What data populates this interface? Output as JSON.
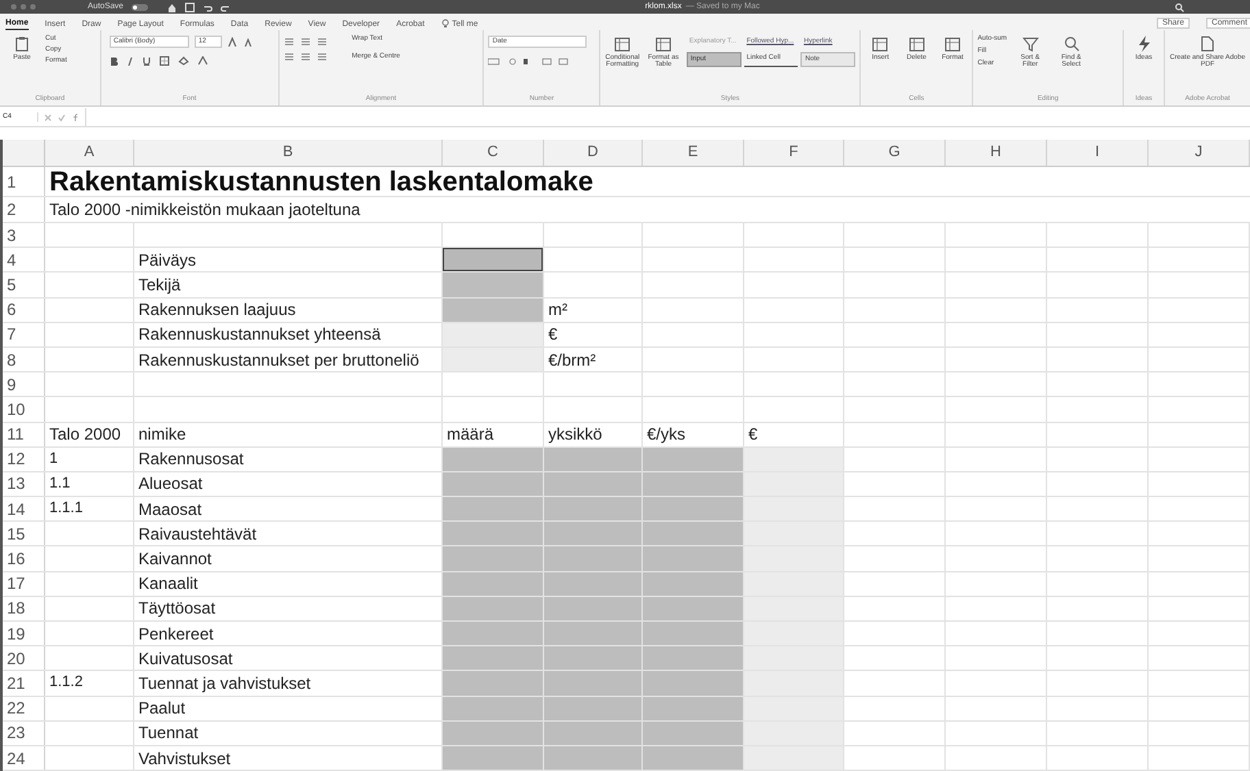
{
  "title_bar": {
    "autosave_label": "AutoSave",
    "autosave_on": false,
    "filename": "rklom.xlsx",
    "status": "— Saved to my Mac"
  },
  "tabs": [
    {
      "label": "Home",
      "selected": true
    },
    {
      "label": "Insert",
      "selected": false
    },
    {
      "label": "Draw",
      "selected": false
    },
    {
      "label": "Page Layout",
      "selected": false
    },
    {
      "label": "Formulas",
      "selected": false
    },
    {
      "label": "Data",
      "selected": false
    },
    {
      "label": "Review",
      "selected": false
    },
    {
      "label": "View",
      "selected": false
    },
    {
      "label": "Developer",
      "selected": false
    },
    {
      "label": "Acrobat",
      "selected": false
    }
  ],
  "tell_me": "Tell me",
  "share_button": "Share",
  "comments_button": "Comment",
  "ribbon": {
    "clipboard": {
      "paste": "Paste",
      "cut": "Cut",
      "copy": "Copy",
      "format": "Format",
      "label": "Clipboard"
    },
    "font": {
      "family": "Calibri (Body)",
      "size": "12",
      "label": "Font"
    },
    "alignment": {
      "wrap": "Wrap Text",
      "merge": "Merge & Centre",
      "label": "Alignment"
    },
    "number": {
      "format": "Date",
      "label": "Number"
    },
    "styles": {
      "conditional": "Conditional Formatting",
      "table": "Format as Table",
      "cells": [
        {
          "label": "Explanatory T...",
          "kind": "plain"
        },
        {
          "label": "Followed Hyp...",
          "kind": "link"
        },
        {
          "label": "Hyperlink",
          "kind": "link"
        },
        {
          "label": "Input",
          "kind": "input"
        },
        {
          "label": "Linked Cell",
          "kind": "underline"
        },
        {
          "label": "Note",
          "kind": "note"
        }
      ],
      "label": "Styles"
    },
    "cells": {
      "insert": "Insert",
      "delete": "Delete",
      "format": "Format",
      "label": "Cells"
    },
    "editing": {
      "autosum": "Auto-sum",
      "fill": "Fill",
      "clear": "Clear",
      "sort": "Sort & Filter",
      "find": "Find & Select",
      "label": "Editing"
    },
    "ideas": {
      "button": "Ideas",
      "label": "Ideas"
    },
    "acrobat": {
      "button": "Create and Share Adobe PDF",
      "label": "Adobe Acrobat"
    }
  },
  "name_box": "C4",
  "columns": [
    "A",
    "B",
    "C",
    "D",
    "E",
    "F",
    "G",
    "H",
    "I",
    "J"
  ],
  "rows": [
    {
      "number": "1",
      "kind": "title",
      "cells": [
        {
          "kind": "text",
          "text": "Rakentamiskustannusten laskentalomake"
        }
      ]
    },
    {
      "number": "2",
      "kind": "plain",
      "cells": [
        {
          "kind": "text",
          "text": "Talo 2000 -nimikkeistön mukaan jaoteltuna"
        }
      ]
    },
    {
      "number": "3",
      "kind": "plain",
      "cells": []
    },
    {
      "number": "4",
      "kind": "plain",
      "cells": [
        {
          "kind": "blank"
        },
        {
          "kind": "text",
          "text": "Päiväys"
        },
        {
          "kind": "input",
          "selected": true
        }
      ]
    },
    {
      "number": "5",
      "kind": "plain",
      "cells": [
        {
          "kind": "blank"
        },
        {
          "kind": "text",
          "text": "Tekijä"
        },
        {
          "kind": "input",
          "selected": false
        }
      ]
    },
    {
      "number": "6",
      "kind": "plain",
      "cells": [
        {
          "kind": "blank"
        },
        {
          "kind": "text",
          "text": "Rakennuksen laajuus"
        },
        {
          "kind": "input",
          "selected": false
        },
        {
          "kind": "text",
          "text": "m²"
        }
      ]
    },
    {
      "number": "7",
      "kind": "plain",
      "cells": [
        {
          "kind": "blank"
        },
        {
          "kind": "text",
          "text": "Rakennuskustannukset yhteensä"
        },
        {
          "kind": "result"
        },
        {
          "kind": "text",
          "text": "€"
        }
      ]
    },
    {
      "number": "8",
      "kind": "plain",
      "cells": [
        {
          "kind": "blank"
        },
        {
          "kind": "text",
          "text": "Rakennuskustannukset per bruttoneliö"
        },
        {
          "kind": "result"
        },
        {
          "kind": "text",
          "text": "€/brm²"
        }
      ]
    },
    {
      "number": "9",
      "kind": "plain",
      "cells": []
    },
    {
      "number": "10",
      "kind": "plain",
      "cells": []
    },
    {
      "number": "11",
      "kind": "plain",
      "cells": [
        {
          "kind": "text",
          "text": "Talo 2000"
        },
        {
          "kind": "text",
          "text": "nimike"
        },
        {
          "kind": "text",
          "text": "määrä"
        },
        {
          "kind": "text",
          "text": "yksikkö"
        },
        {
          "kind": "text",
          "text": "€/yks"
        },
        {
          "kind": "text",
          "text": "€"
        }
      ]
    },
    {
      "number": "12",
      "kind": "plain",
      "cells": [
        {
          "kind": "code",
          "text": "1"
        },
        {
          "kind": "text",
          "text": "Rakennusosat"
        },
        {
          "kind": "input",
          "selected": false
        },
        {
          "kind": "input",
          "selected": false
        },
        {
          "kind": "input",
          "selected": false
        },
        {
          "kind": "result"
        }
      ]
    },
    {
      "number": "13",
      "kind": "plain",
      "cells": [
        {
          "kind": "code",
          "text": "1.1"
        },
        {
          "kind": "text",
          "text": "Alueosat"
        },
        {
          "kind": "input",
          "selected": false
        },
        {
          "kind": "input",
          "selected": false
        },
        {
          "kind": "input",
          "selected": false
        },
        {
          "kind": "result"
        }
      ]
    },
    {
      "number": "14",
      "kind": "plain",
      "cells": [
        {
          "kind": "code",
          "text": "1.1.1"
        },
        {
          "kind": "text",
          "text": "Maaosat"
        },
        {
          "kind": "input",
          "selected": false
        },
        {
          "kind": "input",
          "selected": false
        },
        {
          "kind": "input",
          "selected": false
        },
        {
          "kind": "result"
        }
      ]
    },
    {
      "number": "15",
      "kind": "plain",
      "cells": [
        {
          "kind": "blank"
        },
        {
          "kind": "text",
          "text": "Raivaustehtävät"
        },
        {
          "kind": "input",
          "selected": false
        },
        {
          "kind": "input",
          "selected": false
        },
        {
          "kind": "input",
          "selected": false
        },
        {
          "kind": "result"
        }
      ]
    },
    {
      "number": "16",
      "kind": "plain",
      "cells": [
        {
          "kind": "blank"
        },
        {
          "kind": "text",
          "text": "Kaivannot"
        },
        {
          "kind": "input",
          "selected": false
        },
        {
          "kind": "input",
          "selected": false
        },
        {
          "kind": "input",
          "selected": false
        },
        {
          "kind": "result"
        }
      ]
    },
    {
      "number": "17",
      "kind": "plain",
      "cells": [
        {
          "kind": "blank"
        },
        {
          "kind": "text",
          "text": "Kanaalit"
        },
        {
          "kind": "input",
          "selected": false
        },
        {
          "kind": "input",
          "selected": false
        },
        {
          "kind": "input",
          "selected": false
        },
        {
          "kind": "result"
        }
      ]
    },
    {
      "number": "18",
      "kind": "plain",
      "cells": [
        {
          "kind": "blank"
        },
        {
          "kind": "text",
          "text": "Täyttöosat"
        },
        {
          "kind": "input",
          "selected": false
        },
        {
          "kind": "input",
          "selected": false
        },
        {
          "kind": "input",
          "selected": false
        },
        {
          "kind": "result"
        }
      ]
    },
    {
      "number": "19",
      "kind": "plain",
      "cells": [
        {
          "kind": "blank"
        },
        {
          "kind": "text",
          "text": "Penkereet"
        },
        {
          "kind": "input",
          "selected": false
        },
        {
          "kind": "input",
          "selected": false
        },
        {
          "kind": "input",
          "selected": false
        },
        {
          "kind": "result"
        }
      ]
    },
    {
      "number": "20",
      "kind": "plain",
      "cells": [
        {
          "kind": "blank"
        },
        {
          "kind": "text",
          "text": "Kuivatusosat"
        },
        {
          "kind": "input",
          "selected": false
        },
        {
          "kind": "input",
          "selected": false
        },
        {
          "kind": "input",
          "selected": false
        },
        {
          "kind": "result"
        }
      ]
    },
    {
      "number": "21",
      "kind": "plain",
      "cells": [
        {
          "kind": "code",
          "text": "1.1.2"
        },
        {
          "kind": "text",
          "text": "Tuennat ja vahvistukset"
        },
        {
          "kind": "input",
          "selected": false
        },
        {
          "kind": "input",
          "selected": false
        },
        {
          "kind": "input",
          "selected": false
        },
        {
          "kind": "result"
        }
      ]
    },
    {
      "number": "22",
      "kind": "plain",
      "cells": [
        {
          "kind": "blank"
        },
        {
          "kind": "text",
          "text": "Paalut"
        },
        {
          "kind": "input",
          "selected": false
        },
        {
          "kind": "input",
          "selected": false
        },
        {
          "kind": "input",
          "selected": false
        },
        {
          "kind": "result"
        }
      ]
    },
    {
      "number": "23",
      "kind": "plain",
      "cells": [
        {
          "kind": "blank"
        },
        {
          "kind": "text",
          "text": "Tuennat"
        },
        {
          "kind": "input",
          "selected": false
        },
        {
          "kind": "input",
          "selected": false
        },
        {
          "kind": "input",
          "selected": false
        },
        {
          "kind": "result"
        }
      ]
    },
    {
      "number": "24",
      "kind": "plain",
      "cells": [
        {
          "kind": "blank"
        },
        {
          "kind": "text",
          "text": "Vahvistukset"
        },
        {
          "kind": "input",
          "selected": false
        },
        {
          "kind": "input",
          "selected": false
        },
        {
          "kind": "input",
          "selected": false
        },
        {
          "kind": "result"
        }
      ]
    }
  ]
}
